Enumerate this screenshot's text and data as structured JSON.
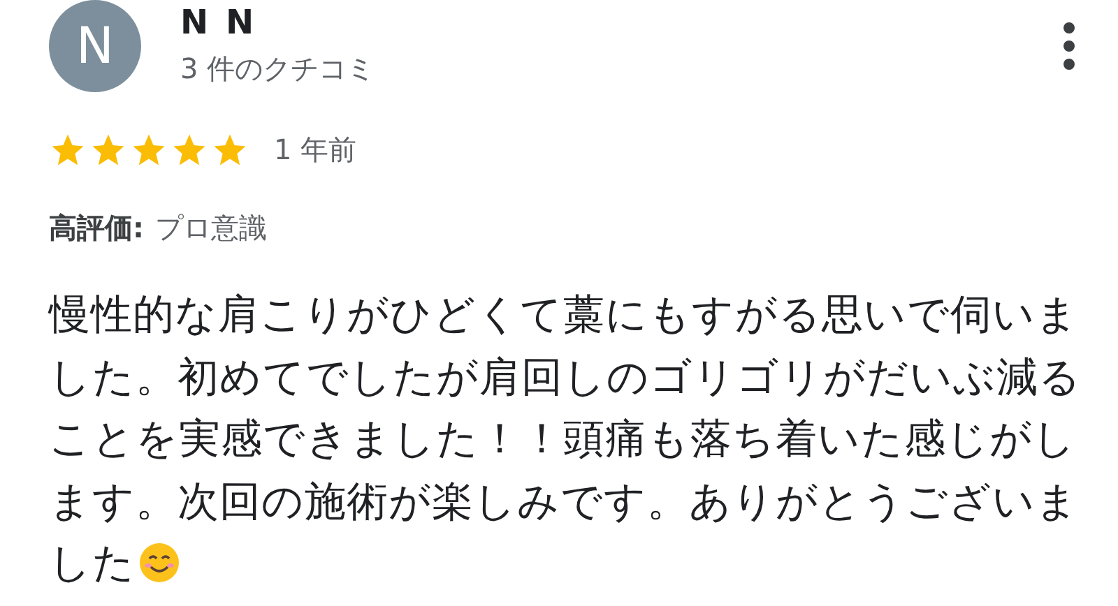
{
  "review": {
    "avatar_letter": "N",
    "author": "N N",
    "review_count": "3 件のクチコミ",
    "stars": 5,
    "time": "1 年前",
    "highlight": {
      "label": "高評価:",
      "value": "プロ意識"
    },
    "body": "慢性的な肩こりがひどくて藁にもすがる思いで伺いました。初めてでしたが肩回しのゴリゴリがだいぶ減ることを実感できました！！頭痛も落ち着いた感じがします。次回の施術が楽しみです。ありがとうございました",
    "ends_with_emoji": true
  }
}
